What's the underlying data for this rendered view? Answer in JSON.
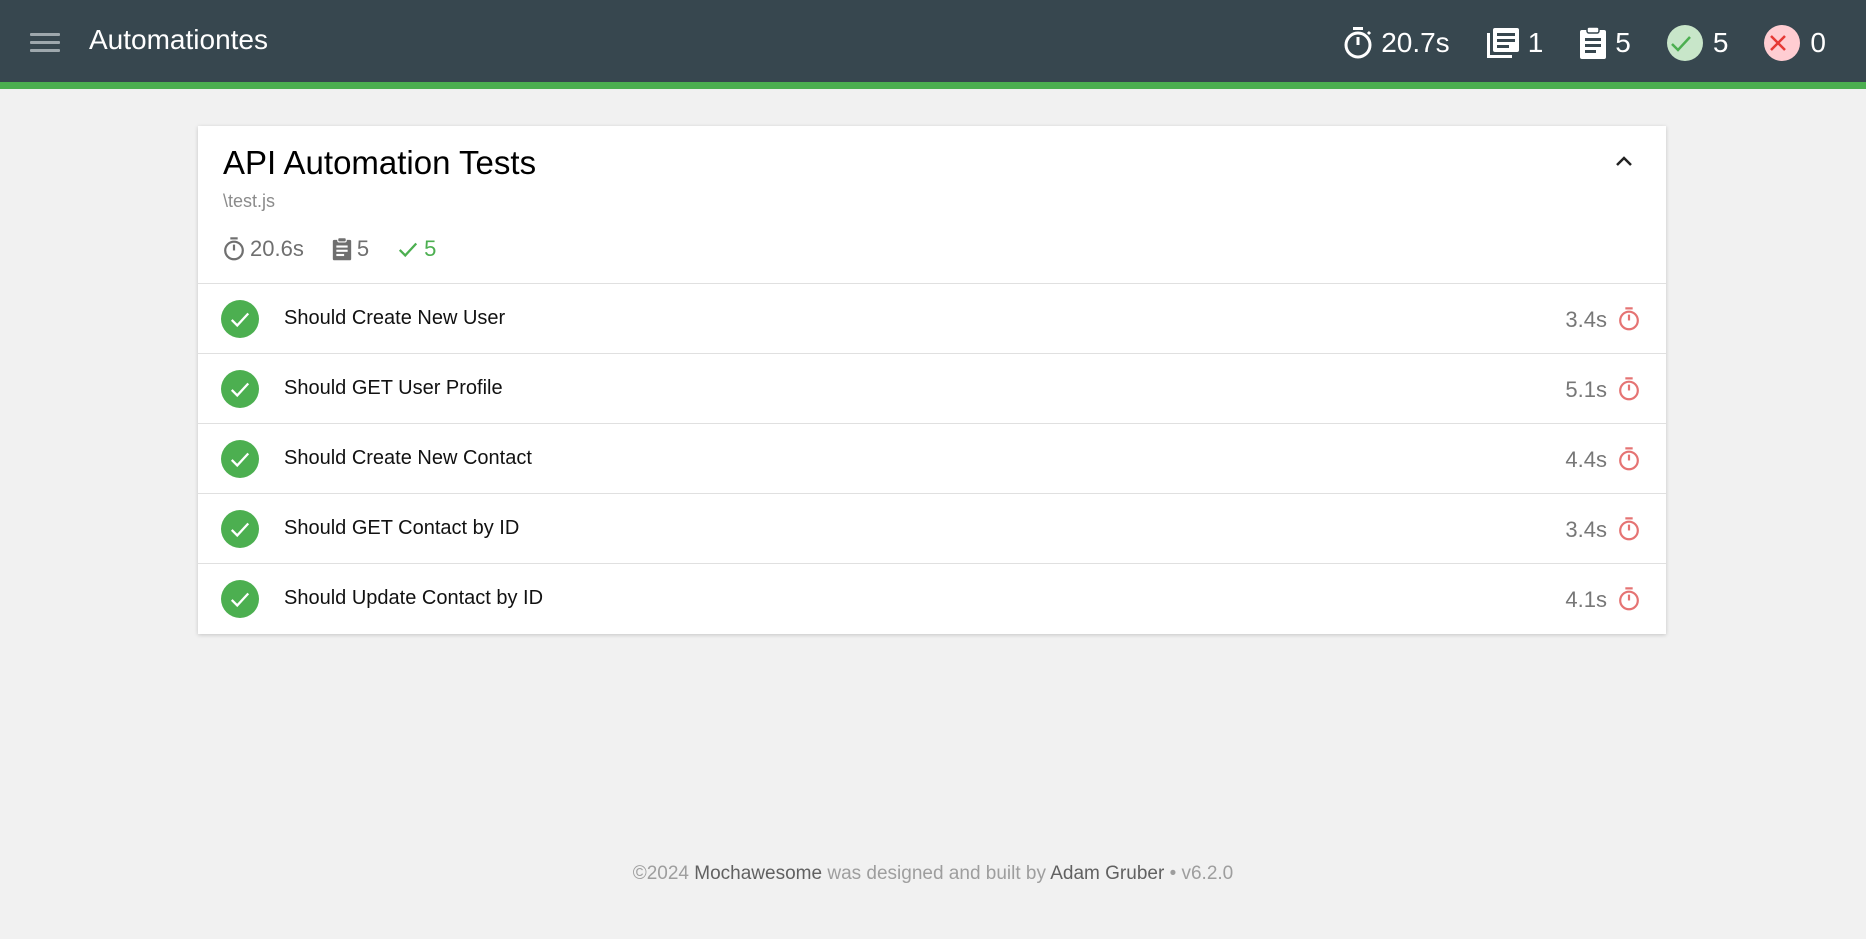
{
  "app": {
    "title": "Automationtes"
  },
  "header_stats": {
    "duration": "20.7s",
    "suites": "1",
    "tests": "5",
    "passes": "5",
    "failures": "0"
  },
  "suite": {
    "title": "API Automation Tests",
    "file": "\\test.js",
    "duration": "20.6s",
    "tests": "5",
    "passes": "5",
    "tests_list": [
      {
        "name": "Should Create New User",
        "duration": "3.4s"
      },
      {
        "name": "Should GET User Profile",
        "duration": "5.1s"
      },
      {
        "name": "Should Create New Contact",
        "duration": "4.4s"
      },
      {
        "name": "Should GET Contact by ID",
        "duration": "3.4s"
      },
      {
        "name": "Should Update Contact by ID",
        "duration": "4.1s"
      }
    ]
  },
  "footer": {
    "copyright": "©2024",
    "project": "Mochawesome",
    "middle": "was designed and built by",
    "author": "Adam Gruber",
    "version": "• v6.2.0"
  },
  "colors": {
    "topbar": "#37474f",
    "accent_green": "#4caf50",
    "fail_red": "#e57373"
  }
}
